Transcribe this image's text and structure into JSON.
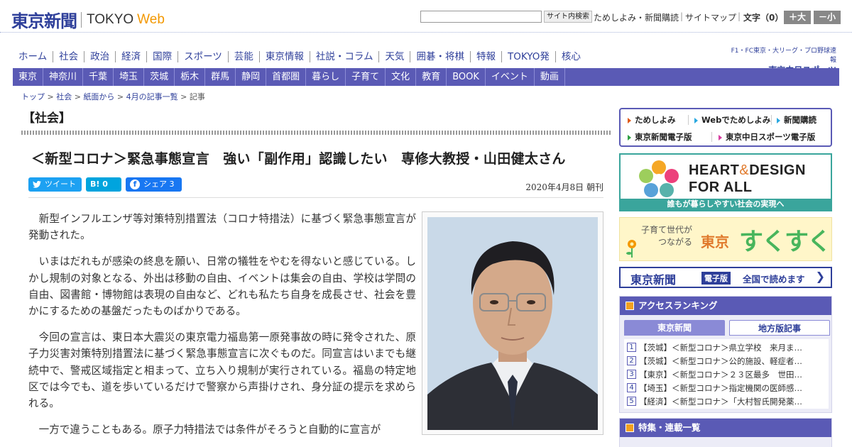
{
  "header": {
    "logo_kanji": "東京新聞",
    "logo_tokyo": "TOKYO",
    "logo_web": "Web",
    "search_button": "サイト内検索",
    "links": [
      "ためしよみ・新聞購読",
      "サイトマップ"
    ],
    "font_label": "文字（0）",
    "font_larger": "＋大",
    "font_smaller": "－小"
  },
  "main_nav": [
    "ホーム",
    "社会",
    "政治",
    "経済",
    "国際",
    "スポーツ",
    "芸能",
    "東京情報",
    "社説・コラム",
    "天気",
    "囲碁・将棋",
    "特報",
    "TOKYO発",
    "核心"
  ],
  "chunichi": {
    "tagline": "F1・FC東京・大リーグ・プロ野球速報",
    "name": "東京中日スポーツ"
  },
  "area_nav": [
    "東京",
    "神奈川",
    "千葉",
    "埼玉",
    "茨城",
    "栃木",
    "群馬",
    "静岡",
    "首都圏",
    "暮らし",
    "子育て",
    "文化",
    "教育",
    "BOOK",
    "イベント",
    "動画"
  ],
  "breadcrumb": [
    "トップ",
    "社会",
    "紙面から",
    "4月の記事一覧",
    "記事"
  ],
  "section_title": "【社会】",
  "article": {
    "headline": "＜新型コロナ＞緊急事態宣言　強い「副作用」認識したい　専修大教授・山田健太さん",
    "share_tweet": "ツイート",
    "share_hatena": "B! 0",
    "share_fb": "シェア 3",
    "fb_letter": "f",
    "date": "2020年4月8日 朝刊",
    "paragraphs": [
      "新型インフルエンザ等対策特別措置法（コロナ特措法）に基づく緊急事態宣言が発動された。",
      "いまはだれもが感染の終息を願い、日常の犠牲をやむを得ないと感じている。しかし規制の対象となる、外出は移動の自由、イベントは集会の自由、学校は学問の自由、図書館・博物館は表現の自由など、どれも私たち自身を成長させ、社会を豊かにするための基盤だったものばかりである。",
      "今回の宣言は、東日本大震災の東京電力福島第一原発事故の時に発令された、原子力災害対策特別措置法に基づく緊急事態宣言に次ぐものだ。同宣言はいまでも継続中で、警戒区域指定と相まって、立ち入り規制が実行されている。福島の特定地区では今でも、道を歩いているだけで警察から声掛けされ、身分証の提示を求められる。",
      "一方で違うこともある。原子力特措法では条件がそろうと自動的に宣言が"
    ]
  },
  "sidebar": {
    "quick_links": [
      "ためしよみ",
      "Webでためしよみ",
      "新聞購読",
      "東京新聞電子版",
      "東京中日スポーツ電子版"
    ],
    "heart_title_1": "HEART",
    "heart_amp": "&",
    "heart_title_2": "DESIGN",
    "heart_title_3": "FOR ALL",
    "heart_tagline": "誰もが暮らしやすい社会の実現へ",
    "suku_line1": "子育て世代が",
    "suku_line2": "つながる",
    "suku_tokyo": "東京",
    "suku_big": "すくすく",
    "denshi_name": "東京新聞",
    "denshi_badge": "電子版",
    "denshi_text": "全国で読めます",
    "ranking_title": "アクセスランキング",
    "ranking_tabs": [
      "東京新聞",
      "地方版記事"
    ],
    "ranking": [
      {
        "num": "1",
        "text": "【茨城】＜新型コロナ＞県立学校　来月ま…"
      },
      {
        "num": "2",
        "text": "【茨城】＜新型コロナ＞公的施設、軽症者…"
      },
      {
        "num": "3",
        "text": "【東京】＜新型コロナ＞２３区最多　世田…"
      },
      {
        "num": "4",
        "text": "【埼玉】＜新型コロナ＞指定機関の医師感…"
      },
      {
        "num": "5",
        "text": "【経済】＜新型コロナ＞「大村智氏開発薬…"
      }
    ],
    "feature_title": "特集・連載一覧"
  },
  "colors": {
    "brand": "#2e3f9a",
    "nav_bg": "#5a5ab5",
    "accent_orange": "#f39800",
    "teal": "#3aa59c"
  }
}
